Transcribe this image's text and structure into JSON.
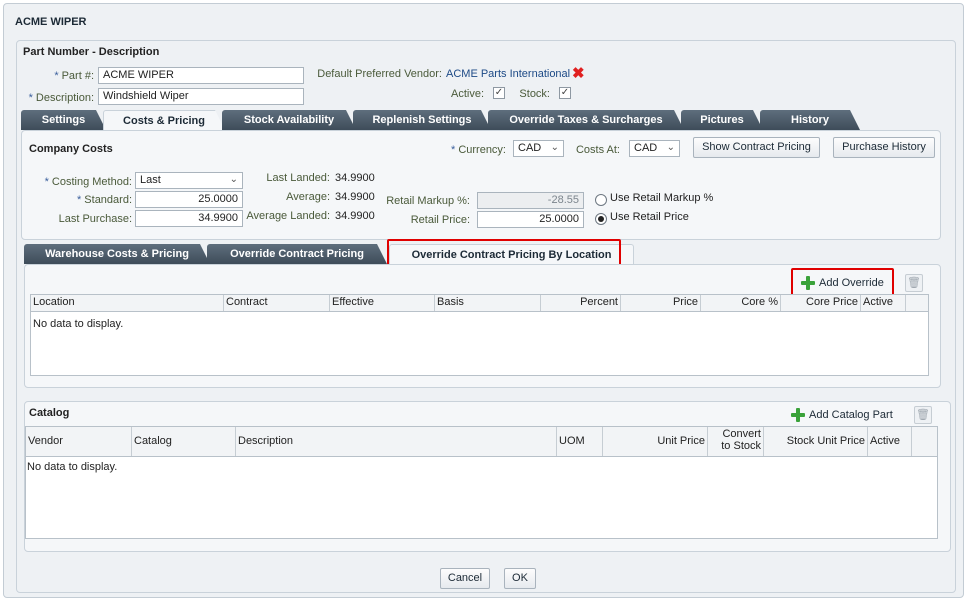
{
  "window": {
    "title": "ACME WIPER"
  },
  "header": {
    "section_title": "Part Number - Description",
    "part_label": "Part #:",
    "part_value": "ACME WIPER",
    "desc_label": "Description:",
    "desc_value": "Windshield Wiper",
    "vendor_label": "Default Preferred Vendor:",
    "vendor_value": "ACME Parts International",
    "active_label": "Active:",
    "stock_label": "Stock:",
    "required_mark": "*",
    "check_mark": "✓",
    "remove_glyph": "✖"
  },
  "tabs": [
    {
      "label": "Settings"
    },
    {
      "label": "Costs & Pricing"
    },
    {
      "label": "Stock Availability"
    },
    {
      "label": "Replenish Settings"
    },
    {
      "label": "Override Taxes & Surcharges"
    },
    {
      "label": "Pictures"
    },
    {
      "label": "History"
    }
  ],
  "company_costs": {
    "title": "Company Costs",
    "currency_label": "Currency:",
    "currency_value": "CAD",
    "costs_at_label": "Costs At:",
    "costs_at_value": "CAD",
    "show_contract_button": "Show Contract Pricing",
    "purchase_history_button": "Purchase History",
    "costing_method_label": "Costing Method:",
    "costing_method_value": "Last",
    "standard_label": "Standard:",
    "standard_value": "25.0000",
    "last_purchase_label": "Last Purchase:",
    "last_purchase_value": "34.9900",
    "last_landed_label": "Last Landed:",
    "last_landed_value": "34.9900",
    "average_label": "Average:",
    "average_value": "34.9900",
    "average_landed_label": "Average Landed:",
    "average_landed_value": "34.9900",
    "retail_markup_label": "Retail Markup %:",
    "retail_markup_value": "-28.55",
    "retail_price_label": "Retail Price:",
    "retail_price_value": "25.0000",
    "use_markup_label": "Use Retail Markup %",
    "use_price_label": "Use Retail Price",
    "dropdown_arrow": "⌄"
  },
  "subtabs": [
    {
      "label": "Warehouse Costs & Pricing"
    },
    {
      "label": "Override Contract Pricing"
    },
    {
      "label": "Override Contract Pricing By Location"
    }
  ],
  "override_grid": {
    "add_button": "Add Override",
    "columns": [
      "Location",
      "Contract",
      "Effective",
      "Basis",
      "Percent",
      "Price",
      "Core %",
      "Core Price",
      "Active"
    ],
    "empty_text": "No data to display."
  },
  "catalog": {
    "title": "Catalog",
    "add_button": "Add Catalog Part",
    "columns": [
      "Vendor",
      "Catalog",
      "Description",
      "UOM",
      "Unit Price",
      "Convert to Stock",
      "Stock Unit Price",
      "Active"
    ],
    "convert_line1": "Convert",
    "convert_line2": "to Stock",
    "empty_text": "No data to display."
  },
  "footer": {
    "cancel": "Cancel",
    "ok": "OK"
  },
  "colors": {
    "accent_red": "#e00000",
    "tab_dark": "#4b5a68",
    "add_green": "#3aa23a"
  }
}
